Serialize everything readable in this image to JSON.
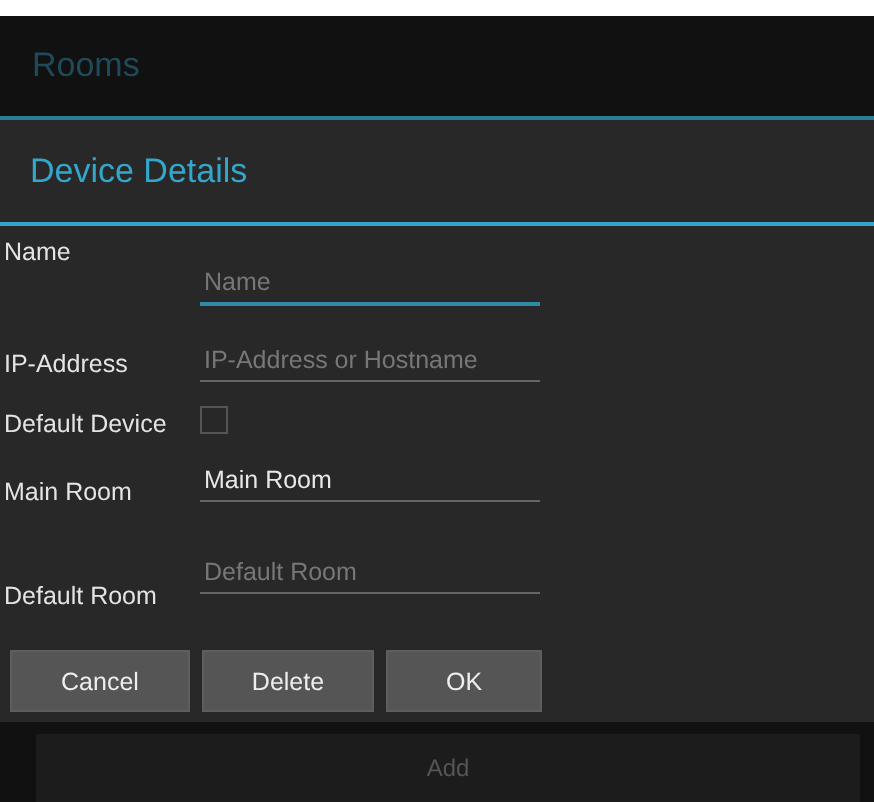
{
  "background": {
    "title": "Rooms",
    "add_button": "Add"
  },
  "dialog": {
    "title": "Device Details",
    "fields": [
      {
        "kind": "text",
        "label": "Name",
        "placeholder": "Name",
        "focused": true
      },
      {
        "kind": "text",
        "label": "IP-Address",
        "placeholder": "IP-Address or Hostname",
        "focused": false
      },
      {
        "kind": "checkbox",
        "label": "Default Device",
        "checked": false
      },
      {
        "kind": "text",
        "label": "Main Room",
        "value": "Main Room",
        "focused": false
      },
      {
        "kind": "text",
        "label": "Default Room",
        "placeholder": "Default Room",
        "focused": false
      }
    ],
    "buttons": [
      "Cancel",
      "Delete",
      "OK"
    ]
  }
}
